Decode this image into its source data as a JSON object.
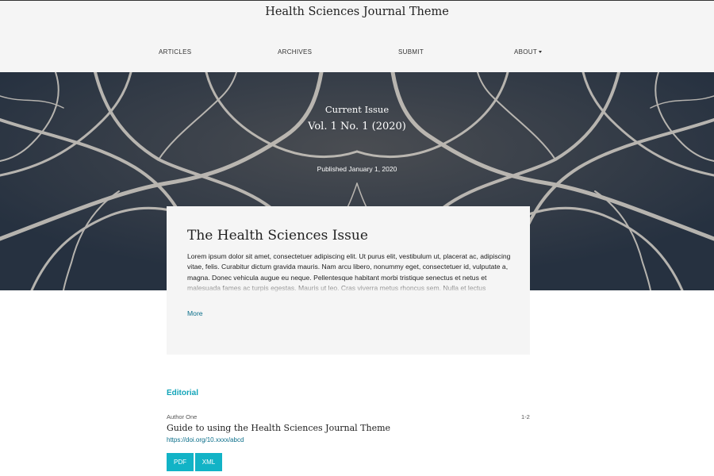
{
  "site": {
    "title": "Health Sciences Journal Theme"
  },
  "nav": {
    "items": [
      {
        "label": "ARTICLES"
      },
      {
        "label": "ARCHIVES"
      },
      {
        "label": "SUBMIT"
      },
      {
        "label": "ABOUT",
        "has_dropdown": true
      }
    ]
  },
  "hero": {
    "label": "Current Issue",
    "volume": "Vol. 1 No. 1 (2020)",
    "published": "Published January 1, 2020"
  },
  "issue": {
    "title": "The Health Sciences Issue",
    "description": "Lorem ipsum dolor sit amet, consectetuer adipiscing elit. Ut purus elit, vestibulum ut, placerat ac, adipiscing vitae, felis. Curabitur dictum gravida mauris. Nam arcu libero, nonummy eget, consectetuer id, vulputate a, magna. Donec vehicula augue eu neque. Pellentesque habitant morbi tristique senectus et netus et malesuada fames ac turpis egestas. Mauris ut leo. Cras viverra metus rhoncus sem. Nulla et lectus vestibulum urna fringilla ultrices.",
    "more_label": "More"
  },
  "toc": {
    "section_title": "Editorial",
    "articles": [
      {
        "author": "Author One",
        "pages": "1-2",
        "title": "Guide to using the Health Sciences Journal Theme",
        "doi": "https://doi.org/10.xxxx/abcd",
        "galleys": [
          {
            "label": "PDF"
          },
          {
            "label": "XML"
          }
        ]
      }
    ]
  },
  "colors": {
    "accent": "#12b3c6",
    "link": "#0a6e8a",
    "header_bg": "#f5f5f5",
    "card_bg": "#f5f5f5"
  }
}
